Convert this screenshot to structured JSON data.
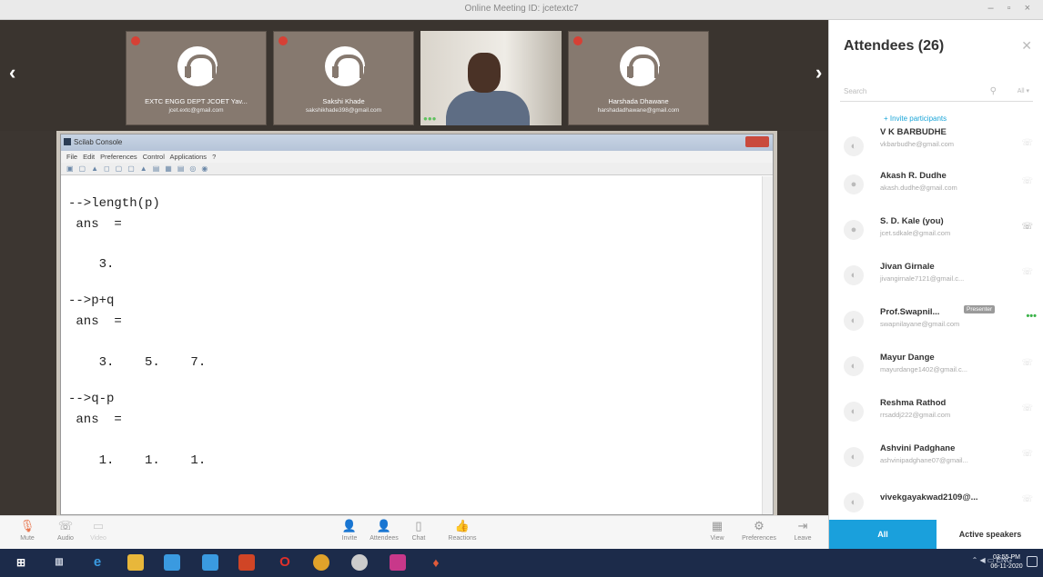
{
  "window": {
    "title": "Online Meeting ID: jcetextc7",
    "controls": "– ▫ ×"
  },
  "tiles": [
    {
      "name": "EXTC ENGG DEPT JCOET Yav...",
      "email": "jcet.extc@gmail.com"
    },
    {
      "name": "Sakshi Khade",
      "email": "sakshikhade398@gmail.com"
    },
    {
      "name": "Harshada Dhawane",
      "email": "harshadadhawane@gmail.com"
    }
  ],
  "nav": {
    "prev": "‹",
    "next": "›"
  },
  "app": {
    "title": "Scilab Console",
    "menu": "File Edit Preferences Control Applications ?",
    "lines": [
      "-->length(p)",
      " ans  =",
      "    3.",
      "-->p+q",
      " ans  =",
      "    3.    5.    7.",
      "-->q-p",
      " ans  =",
      "    1.    1.    1."
    ]
  },
  "controls": {
    "mute": "Mute",
    "audio": "Audio",
    "video": "Video",
    "invite": "Invite",
    "attendees": "Attendees",
    "chat": "Chat",
    "reactions": "Reactions",
    "view": "View",
    "preferences": "Preferences",
    "leave": "Leave"
  },
  "panel": {
    "title": "Attendees (26)",
    "search_placeholder": "Search",
    "filter": "All ▾",
    "invite": "+ Invite participants",
    "attendees": [
      {
        "name": "V K BARBUDHE",
        "email": "vkbarbudhe@gmail.com"
      },
      {
        "name": "Akash R. Dudhe",
        "email": "akash.dudhe@gmail.com"
      },
      {
        "name": "S. D. Kale (you)",
        "email": "jcet.sdkale@gmail.com"
      },
      {
        "name": "Jivan Girnale",
        "email": "jivangirnale7121@gmail.c..."
      },
      {
        "name": "Prof.Swapnil...",
        "email": "swapnilayane@gmail.com",
        "badge": "Presenter"
      },
      {
        "name": "Mayur Dange",
        "email": "mayurdange1402@gmail.c..."
      },
      {
        "name": "Reshma Rathod",
        "email": "rrsaddj222@gmail.com"
      },
      {
        "name": "Ashvini Padghane",
        "email": "ashvinipadghane07@gmail..."
      },
      {
        "name": "vivekgayakwad2109@...",
        "email": ""
      }
    ],
    "tab_all": "All",
    "tab_active": "Active speakers"
  },
  "taskbar": {
    "lang": "ENG",
    "time": "03:55 PM",
    "date": "06-11-2020"
  }
}
